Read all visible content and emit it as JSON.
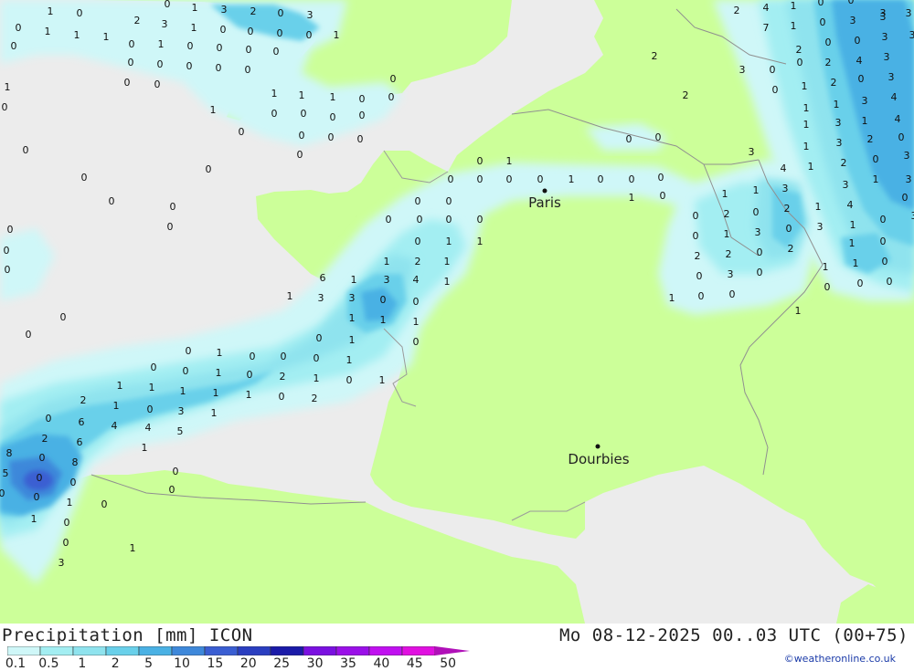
{
  "title": "Precipitation [mm] ICON",
  "datetime": "Mo 08-12-2025 00..03 UTC (00+75)",
  "credit": "©weatheronline.co.uk",
  "colors": {
    "sea": "#ececec",
    "land": "#ccff99",
    "p01": "#cff7f8",
    "p05": "#a3eef2",
    "p1": "#8fe3ee",
    "p2": "#69d0ea",
    "p5": "#4ab1e4",
    "p10": "#3e88da",
    "p15": "#3a5ed2"
  },
  "legend": {
    "ticks": [
      "0.1",
      "0.5",
      "1",
      "2",
      "5",
      "10",
      "15",
      "20",
      "25",
      "30",
      "35",
      "40",
      "45",
      "50"
    ],
    "colors": [
      "#cff7f8",
      "#a3eef2",
      "#8fe3ee",
      "#69d0ea",
      "#4ab1e4",
      "#3e88da",
      "#3a5ed2",
      "#2a3ec0",
      "#1a1aa8",
      "#7a10e0",
      "#9a10e8",
      "#c010f0",
      "#e010e0",
      "#b010b8"
    ]
  },
  "cities": [
    {
      "name": "Paris"
    },
    {
      "name": "Dourbies"
    }
  ],
  "values": [
    "1",
    "0",
    "0",
    "1",
    "3",
    "2",
    "0",
    "3",
    "0",
    "1",
    "1",
    "1",
    "2",
    "3",
    "1",
    "0",
    "0",
    "0",
    "0",
    "1",
    "0",
    "0",
    "1",
    "0",
    "0",
    "0",
    "0",
    "0",
    "0",
    "0",
    "0",
    "0",
    "0",
    "0",
    "1",
    "0",
    "1",
    "1",
    "1",
    "0",
    "0",
    "0",
    "1",
    "0",
    "0",
    "0",
    "0",
    "0",
    "0",
    "0",
    "0",
    "0",
    "0",
    "0",
    "0",
    "0",
    "0",
    "0",
    "0",
    "0",
    "0",
    "0",
    "0",
    "0",
    "1",
    "0",
    "0",
    "0",
    "0",
    "1",
    "0",
    "0",
    "0",
    "1",
    "0",
    "0",
    "0",
    "0",
    "0",
    "0",
    "0",
    "0",
    "1",
    "1",
    "1",
    "2",
    "1",
    "1",
    "3",
    "4",
    "1",
    "6",
    "1",
    "3",
    "3",
    "0",
    "0",
    "1",
    "1",
    "1",
    "0",
    "0",
    "1",
    "0",
    "1",
    "0",
    "0",
    "0",
    "1",
    "0",
    "0",
    "1",
    "0",
    "2",
    "1",
    "0",
    "1",
    "1",
    "1",
    "1",
    "1",
    "1",
    "0",
    "2",
    "2",
    "1",
    "0",
    "3",
    "1",
    "0",
    "6",
    "4",
    "4",
    "5",
    "2",
    "6",
    "1",
    "8",
    "0",
    "8",
    "5",
    "0",
    "0",
    "0",
    "0",
    "1",
    "0",
    "0",
    "0",
    "1",
    "0",
    "0",
    "1",
    "3",
    "2",
    "2",
    "4",
    "1",
    "0",
    "0",
    "3",
    "3",
    "7",
    "1",
    "0",
    "3",
    "3",
    "2",
    "0",
    "0",
    "3",
    "3",
    "3",
    "0",
    "0",
    "2",
    "4",
    "3",
    "0",
    "1",
    "2",
    "0",
    "3",
    "2",
    "1",
    "1",
    "3",
    "4",
    "1",
    "3",
    "1",
    "4",
    "1",
    "3",
    "2",
    "0",
    "3",
    "1",
    "2",
    "0",
    "3",
    "4",
    "3",
    "1",
    "3",
    "1",
    "1",
    "3",
    "0",
    "0",
    "2",
    "0",
    "2",
    "1",
    "4",
    "0",
    "3",
    "0",
    "1",
    "3",
    "0",
    "3",
    "1",
    "0",
    "2",
    "2",
    "0",
    "2",
    "1",
    "1",
    "0",
    "0",
    "3",
    "0",
    "1",
    "0",
    "0",
    "1",
    "0",
    "0",
    "0",
    "1",
    "0",
    "0",
    "0",
    "0",
    "0",
    "0"
  ]
}
